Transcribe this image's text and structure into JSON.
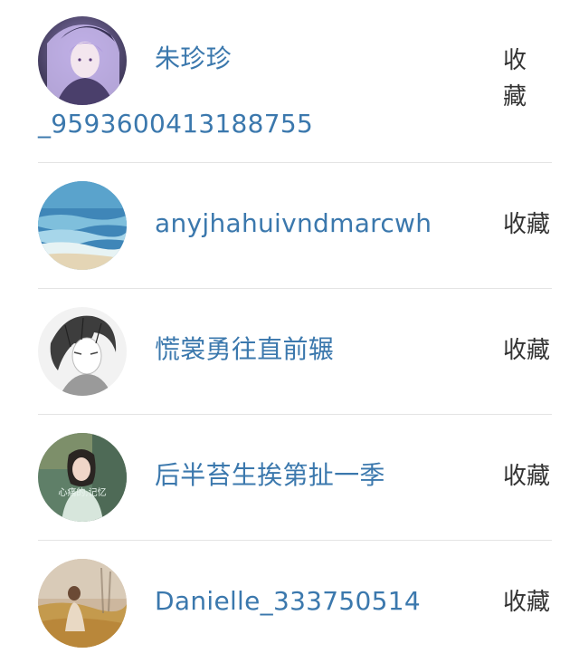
{
  "follow_list": {
    "items": [
      {
        "name_line1": "朱珍珍",
        "name_line2": "_9593600413188755",
        "action_label": "收藏",
        "avatar": "anime-girl-purple-hair-avatar"
      },
      {
        "name_line1": "anyjhahuivndmarcwh",
        "action_label": "收藏",
        "avatar": "ocean-beach-avatar"
      },
      {
        "name_line1": "慌裳勇往直前辗",
        "action_label": "收藏",
        "avatar": "anime-boy-sketch-avatar"
      },
      {
        "name_line1": "后半苔生挨第扯一季",
        "action_label": "收藏",
        "avatar": "girl-photo-avatar",
        "avatar_caption": "心痛的,记忆"
      },
      {
        "name_line1": "Danielle_333750514",
        "action_label": "收藏",
        "avatar": "girl-in-field-avatar"
      }
    ]
  }
}
